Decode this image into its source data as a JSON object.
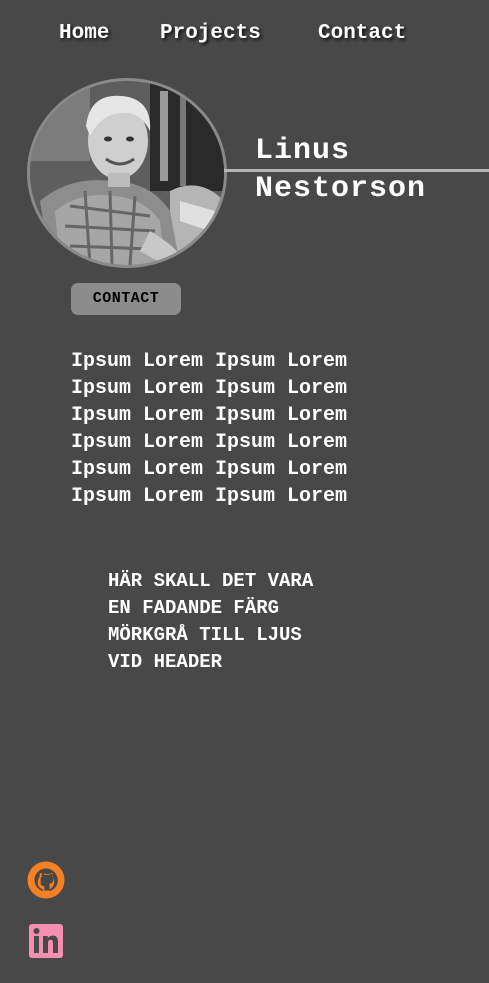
{
  "nav": {
    "items": [
      {
        "label": "Home"
      },
      {
        "label": "Projects"
      },
      {
        "label": "Contact"
      }
    ]
  },
  "profile": {
    "first_name": "Linus",
    "last_name": "Nestorson"
  },
  "contact_button": {
    "label": "CONTACT"
  },
  "intro": {
    "lines": [
      "Ipsum Lorem Ipsum Lorem",
      "Ipsum Lorem Ipsum Lorem",
      "Ipsum Lorem Ipsum Lorem",
      "Ipsum Lorem Ipsum Lorem",
      "Ipsum Lorem Ipsum Lorem",
      "Ipsum Lorem Ipsum Lorem"
    ]
  },
  "note": {
    "lines": [
      "HÄR SKALL DET VARA",
      "EN FADANDE FÄRG",
      "MÖRKGRÅ TILL LJUS",
      "VID HEADER"
    ]
  },
  "social": {
    "github": {
      "icon": "github-icon",
      "color": "#F58025"
    },
    "linkedin": {
      "icon": "linkedin-icon",
      "color": "#F48FB1"
    }
  },
  "colors": {
    "background": "#484848",
    "button": "#8C8C8C",
    "text": "#FFFFFF"
  }
}
